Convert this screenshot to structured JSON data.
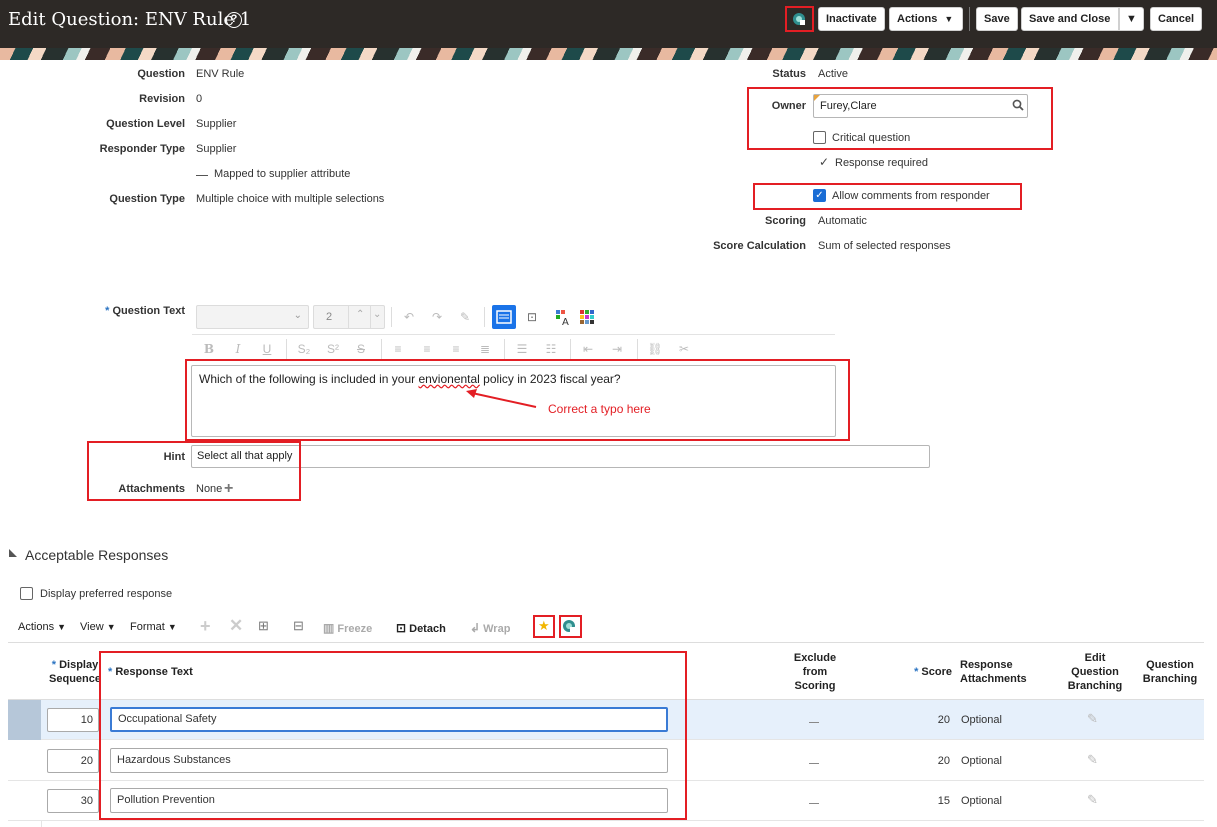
{
  "header": {
    "title": "Edit Question: ENV Rule 1",
    "buttons": {
      "inactivate": "Inactivate",
      "actions": "Actions",
      "save": "Save",
      "save_and_close": "Save and Close",
      "cancel": "Cancel"
    },
    "caret": "▼"
  },
  "details_left": [
    {
      "label": "Question",
      "value": "ENV Rule"
    },
    {
      "label": "Revision",
      "value": "0"
    },
    {
      "label": "Question Level",
      "value": "Supplier"
    },
    {
      "label": "Responder Type",
      "value": "Supplier"
    }
  ],
  "mapped_attribute": "Mapped to supplier attribute",
  "question_type": {
    "label": "Question Type",
    "value": "Multiple choice with multiple selections"
  },
  "details_right": {
    "status_label": "Status",
    "status_value": "Active",
    "owner_label": "Owner",
    "owner_value": "Furey,Clare",
    "critical_label": "Critical question",
    "response_required_label": "Response required",
    "allow_comments_label": "Allow comments from responder",
    "scoring_label": "Scoring",
    "scoring_value": "Automatic",
    "score_calc_label": "Score Calculation",
    "score_calc_value": "Sum of selected responses"
  },
  "question_text": {
    "required_mark": "*",
    "label": "Question Text",
    "font_size_value": "2",
    "content_before": "Which of the following is included in your ",
    "typo_word": "envionental",
    "content_after": " policy in 2023 fiscal year?"
  },
  "annotation": {
    "text": "Correct a typo here",
    "color": "#e31e24"
  },
  "hint": {
    "label": "Hint",
    "value": "Select all that apply"
  },
  "attachments": {
    "label": "Attachments",
    "value": "None"
  },
  "responses": {
    "section_title": "Acceptable Responses",
    "display_preferred_label": "Display preferred response",
    "toolbar": {
      "actions": "Actions",
      "view": "View",
      "format": "Format",
      "freeze": "Freeze",
      "detach": "Detach",
      "wrap": "Wrap"
    },
    "columns": {
      "display_sequence": [
        "Display",
        "Sequence"
      ],
      "response_text": "Response Text",
      "exclude_from_scoring": [
        "Exclude",
        "from",
        "Scoring"
      ],
      "score": "Score",
      "response_attachments": [
        "Response",
        "Attachments"
      ],
      "edit_branching": [
        "Edit",
        "Question",
        "Branching"
      ],
      "question_branching": [
        "Question",
        "Branching"
      ]
    },
    "rows": [
      {
        "sequence": "10",
        "text": "Occupational Safety",
        "score": "20",
        "attachments": "Optional"
      },
      {
        "sequence": "20",
        "text": "Hazardous Substances",
        "score": "20",
        "attachments": "Optional"
      },
      {
        "sequence": "30",
        "text": "Pollution Prevention",
        "score": "15",
        "attachments": "Optional"
      }
    ]
  }
}
